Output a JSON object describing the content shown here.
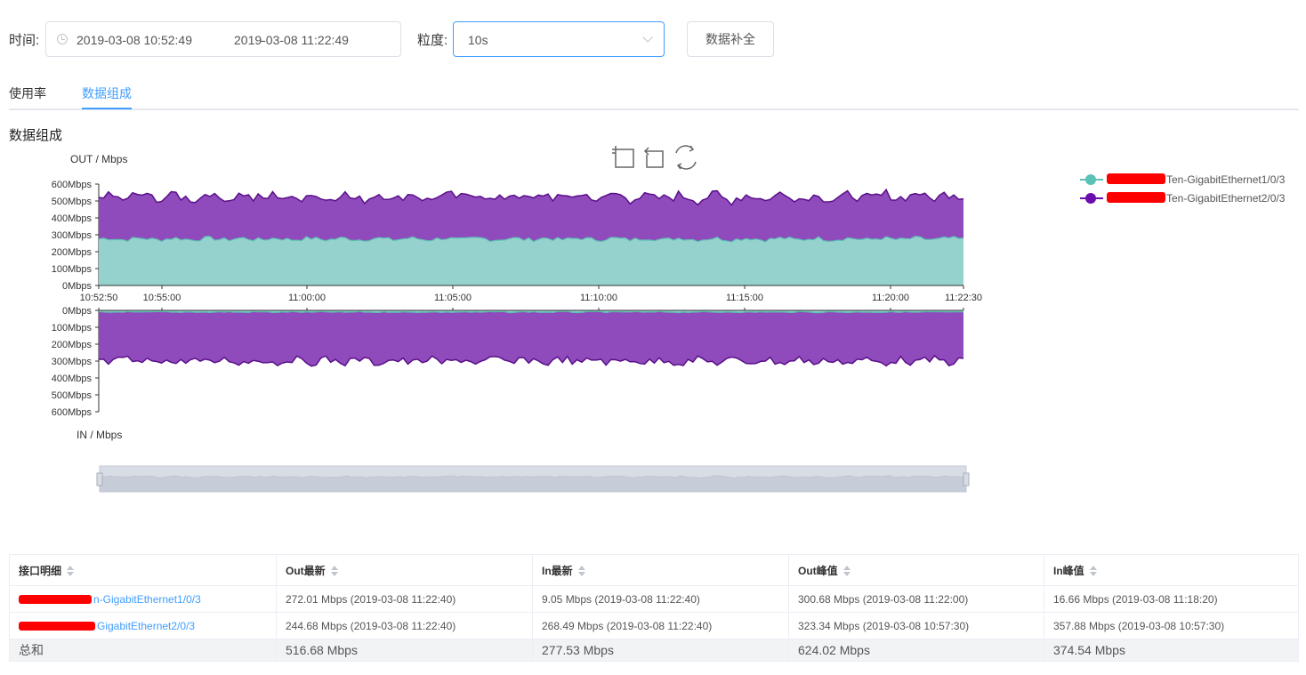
{
  "filter": {
    "time_label": "时间:",
    "start": "2019-03-08 10:52:49",
    "separator": "-",
    "end": "2019-03-08 11:22:49",
    "granularity_label": "粒度:",
    "granularity_value": "10s",
    "supplement_button": "数据补全"
  },
  "tabs": [
    {
      "label": "使用率",
      "active": false
    },
    {
      "label": "数据组成",
      "active": true
    }
  ],
  "section_title": "数据组成",
  "toolbox": [
    "zoom-select-icon",
    "zoom-reset-icon",
    "restore-icon"
  ],
  "legend": [
    {
      "name": "Ten-GigabitEthernet1/0/3",
      "color": "#5bc0b5"
    },
    {
      "name": "Ten-GigabitEthernet2/0/3",
      "color": "#6a0dad"
    }
  ],
  "chart_data": [
    {
      "type": "area",
      "stacked": true,
      "ylabel": "OUT / Mbps",
      "ylim": [
        0,
        600
      ],
      "yticks": [
        "600Mbps",
        "500Mbps",
        "400Mbps",
        "300Mbps",
        "200Mbps",
        "100Mbps",
        "0Mbps"
      ],
      "xticks": [
        "10:52:50",
        "10:55:00",
        "11:00:00",
        "11:05:00",
        "11:10:00",
        "11:15:00",
        "11:20:00",
        "11:22:30"
      ],
      "series": [
        {
          "name": "Ten-GigabitEthernet1/0/3",
          "color": "#95d2cd",
          "line": "#5bc0b5",
          "mean": 275,
          "amp": 12
        },
        {
          "name": "Ten-GigabitEthernet2/0/3",
          "color": "#8f4bbb",
          "line": "#5a0f8a",
          "mean": 250,
          "amp": 25
        }
      ]
    },
    {
      "type": "area",
      "stacked": true,
      "inverted": true,
      "ylabel": "IN / Mbps",
      "ylim": [
        0,
        600
      ],
      "yticks": [
        "0Mbps",
        "100Mbps",
        "200Mbps",
        "300Mbps",
        "400Mbps",
        "500Mbps",
        "600Mbps"
      ],
      "series": [
        {
          "name": "Ten-GigabitEthernet1/0/3",
          "color": "#95d2cd",
          "line": "#5bc0b5",
          "mean": 10,
          "amp": 3
        },
        {
          "name": "Ten-GigabitEthernet2/0/3",
          "color": "#8f4bbb",
          "line": "#5a0f8a",
          "mean": 290,
          "amp": 22
        }
      ]
    }
  ],
  "table": {
    "headers": [
      "接口明细",
      "Out最新",
      "In最新",
      "Out峰值",
      "In峰值"
    ],
    "rows": [
      {
        "iface": "n-GigabitEthernet1/0/3",
        "out_latest": "272.01  Mbps  (2019-03-08 11:22:40)",
        "in_latest": "9.05  Mbps  (2019-03-08 11:22:40)",
        "out_peak": "300.68  Mbps  (2019-03-08 11:22:00)",
        "in_peak": "16.66  Mbps  (2019-03-08 11:18:20)"
      },
      {
        "iface": "GigabitEthernet2/0/3",
        "out_latest": "244.68  Mbps  (2019-03-08 11:22:40)",
        "in_latest": "268.49  Mbps  (2019-03-08 11:22:40)",
        "out_peak": "323.34  Mbps  (2019-03-08 10:57:30)",
        "in_peak": "357.88  Mbps  (2019-03-08 10:57:30)"
      }
    ],
    "total": [
      "总和",
      "516.68 Mbps",
      "277.53 Mbps",
      "624.02 Mbps",
      "374.54 Mbps"
    ]
  }
}
